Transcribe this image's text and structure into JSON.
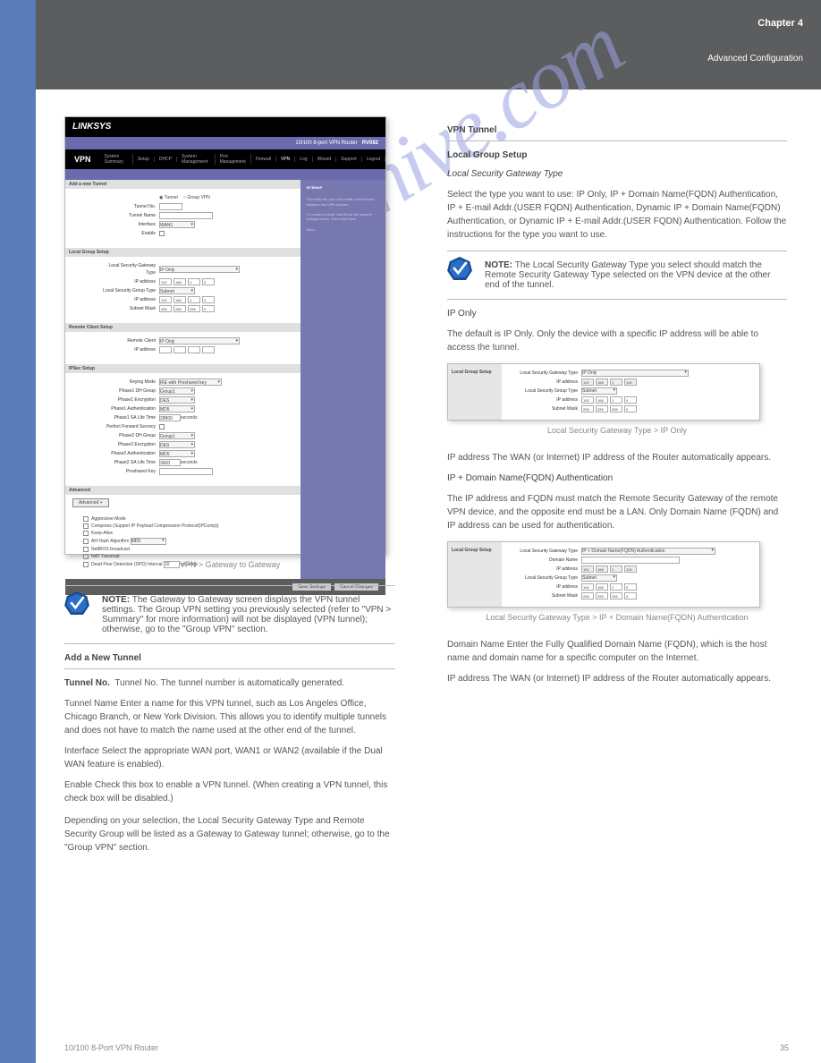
{
  "chapter": {
    "num": "Chapter 4",
    "title": "Advanced Configuration"
  },
  "footer": {
    "left": "10/100 8-Port VPN Router",
    "right": "35"
  },
  "watermark": "manualshive.com",
  "shot1": {
    "brand": "LINKSYS",
    "titlebar_model": "RV082",
    "titlebar_desc": "10/100 8-port VPN Router",
    "nav_main": "VPN",
    "nav": [
      "System Summary",
      "Setup",
      "DHCP",
      "System Management",
      "Port Management",
      "Firewall",
      "VPN",
      "Log",
      "Wizard",
      "Support",
      "Logout"
    ],
    "sitemap": "SITEMAP",
    "caption": "VPN > Gateway to Gateway",
    "tab_add": "Add a new Tunnel",
    "tunnel_opt1": "Tunnel",
    "tunnel_opt2": "Group VPN",
    "f_tunnel_no": "Tunnel No.",
    "f_tunnel_name": "Tunnel Name",
    "f_interface": "Interface",
    "f_interface_val": "WAN1",
    "f_enable": "Enable",
    "sect_local": "Local Group Setup",
    "f_lsgt": "Local Security Gateway Type",
    "f_lsgt_val": "IP Only",
    "f_ip": "IP address",
    "ip_vals": [
      "192",
      "168",
      "1",
      "0"
    ],
    "f_lsgtype": "Local Security Group Type",
    "f_lsgtype_val": "Subnet",
    "f_subnet": "Subnet Mask",
    "subnet_vals": [
      "255",
      "255",
      "255",
      "0"
    ],
    "sect_remote": "Remote Client Setup",
    "f_remote_client": "Remote Client",
    "f_remote_client_val": "IP Only",
    "f_ip_addr": "IP address",
    "sect_ipsec": "IPSec Setup",
    "f_keying": "Keying Mode",
    "f_keying_val": "IKE with Preshared key",
    "f_p1dh": "Phase1 DH Group",
    "f_p1dh_val": "Group1",
    "f_p1enc": "Phase1 Encryption",
    "f_p1enc_val": "DES",
    "f_p1auth": "Phase1 Authentication",
    "f_p1auth_val": "MD5",
    "f_p1life": "Phase1 SA Life Time",
    "f_p1life_val": "28800",
    "f_pfs": "Perfect Forward Secrecy",
    "f_p2dh": "Phase2 DH Group",
    "f_p2dh_val": "Group1",
    "f_p2enc": "Phase2 Encryption",
    "f_p2enc_val": "DES",
    "f_p2auth": "Phase2 Authentication",
    "f_p2auth_val": "MD5",
    "f_p2life": "Phase2 SA Life Time",
    "f_p2life_val": "3600",
    "f_psk": "Preshared Key",
    "seconds": "seconds",
    "sect_adv": "Advanced",
    "btn_adv": "Advanced +",
    "adv1": "Aggressive Mode",
    "adv2": "Compress (Support IP Payload Compression Protocol(IPComp))",
    "adv3": "Keep-Alive",
    "adv4": "AH Hash Algorithm",
    "adv4_val": "MD5",
    "adv5": "NetBIOS broadcast",
    "adv6": "NAT Traversal",
    "adv7": "Dead Peer Detection (DPD)  Interval",
    "adv7_val": "10",
    "btn_save": "Save Settings",
    "btn_cancel": "Cancel Changes"
  },
  "note1": {
    "label": "NOTE:",
    "text": "The Gateway to Gateway screen displays the VPN tunnel settings. The Group VPN setting you previously selected (refer to \"VPN > Summary\" for more information) will not be displayed (VPN tunnel); otherwise, go to the \"Group VPN\" section."
  },
  "leftcol": {
    "h_addtunnel": "Add a New Tunnel",
    "p1": "Tunnel No.  The tunnel number is automatically generated.",
    "p2": "Tunnel Name  Enter a name for this VPN tunnel, such as Los Angeles Office, Chicago Branch, or New York Division. This allows you to identify multiple tunnels and does not have to match the name used at the other end of the tunnel.",
    "p3": "Interface  Select the appropriate WAN port, WAN1 or WAN2 (available if the Dual WAN feature is enabled).",
    "p4": "Enable  Check this box to enable a VPN tunnel. (When creating a VPN tunnel, this check box will be disabled.)",
    "p5": "Depending on your selection, the Local Security Gateway Type and Remote Security Group will be listed as a Gateway to Gateway tunnel; otherwise, go to the \"Group VPN\" section."
  },
  "rightcol": {
    "h_tunnel": "VPN Tunnel",
    "h_lgs": "Local Group Setup",
    "h_lsgt": "Local Security Gateway Type",
    "p_intro1": "Select the type you want to use: IP Only, IP + Domain Name(FQDN) Authentication, IP + E-mail Addr.(USER FQDN) Authentication, Dynamic IP + Domain Name(FQDN) Authentication, or Dynamic IP + E-mail Addr.(USER FQDN) Authentication. Follow the instructions for the type you want to use.",
    "note2_label": "NOTE:",
    "note2_text": "The Local Security Gateway Type you select should match the Remote Security Gateway Type selected on the VPN device at the other end of the tunnel.",
    "h_iponly": "IP Only",
    "p_iponly": "The default is IP Only. Only the device with a specific IP address will be able to access the tunnel.",
    "mini1_caption": "Local Security Gateway Type > IP Only",
    "f_ip_auto": "IP address  The WAN (or Internet) IP address of the Router automatically appears.",
    "h_ipfqdn": "IP + Domain Name(FQDN) Authentication",
    "p_ipfqdn": "The IP address and FQDN must match the Remote Security Gateway of the remote VPN device, and the opposite end must be a LAN. Only Domain Name (FQDN) and IP address can be used for authentication.",
    "mini2_caption": "Local Security Gateway Type > IP + Domain Name(FQDN) Authentication",
    "mini2_type_val": "IP + Domain Name(FQDN) Authentication",
    "f_domain": "Domain Name",
    "p_domain": "Domain Name  Enter the Fully Qualified Domain Name (FQDN), which is the host name and domain name for a specific computer on the Internet.",
    "p_ipauto2": "IP address  The WAN (or Internet) IP address of the Router automatically appears."
  }
}
